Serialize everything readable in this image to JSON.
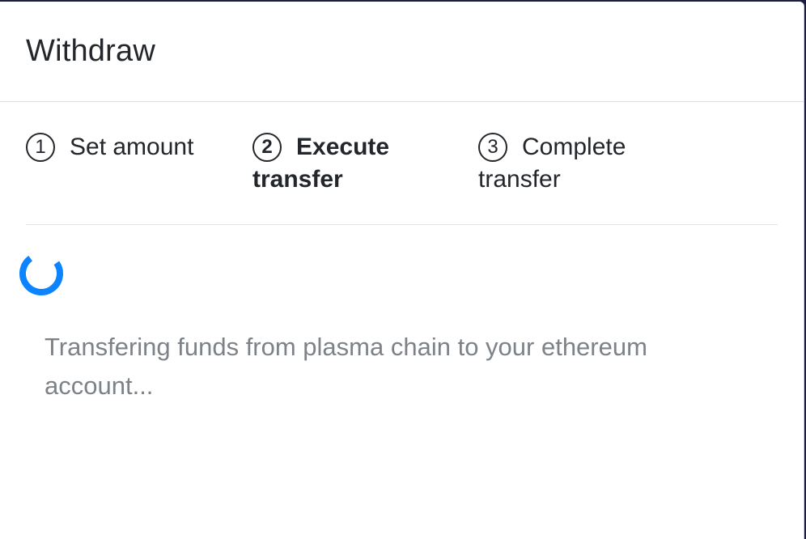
{
  "modal": {
    "title": "Withdraw"
  },
  "steps": [
    {
      "number": "1",
      "label": "Set amount",
      "state": "done"
    },
    {
      "number": "2",
      "label": "Execute transfer",
      "state": "active"
    },
    {
      "number": "3",
      "label": "Complete transfer",
      "state": "pending"
    }
  ],
  "status": {
    "message": "Transfering funds from plasma chain to your ethereum account..."
  },
  "colors": {
    "backdrop": "#1b1d45",
    "spinner": "#0d84ff",
    "text_primary": "#23272b",
    "text_muted": "#7c8288"
  },
  "icons": {
    "spinner": "loading-spinner-icon"
  }
}
